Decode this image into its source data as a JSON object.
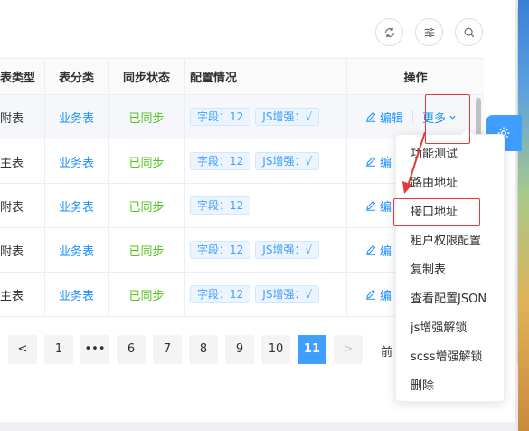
{
  "toolbar": {
    "icons": [
      "refresh-icon",
      "columns-settings-icon",
      "search-icon"
    ]
  },
  "table": {
    "headers": [
      "表类型",
      "表分类",
      "同步状态",
      "配置情况",
      "操作"
    ],
    "rows": [
      {
        "type": "附表",
        "category": "业务表",
        "sync": "已同步",
        "tags": [
          "字段：12",
          "JS增强：√"
        ],
        "edit": "编辑",
        "more": "更多"
      },
      {
        "type": "主表",
        "category": "业务表",
        "sync": "已同步",
        "tags": [
          "字段：12",
          "JS增强：√"
        ],
        "edit": "编"
      },
      {
        "type": "附表",
        "category": "业务表",
        "sync": "已同步",
        "tags": [
          "字段：12"
        ],
        "edit": "编"
      },
      {
        "type": "附表",
        "category": "业务表",
        "sync": "已同步",
        "tags": [
          "字段：12",
          "JS增强：√"
        ],
        "edit": "编"
      },
      {
        "type": "主表",
        "category": "业务表",
        "sync": "已同步",
        "tags": [
          "字段：12",
          "JS增强：√"
        ],
        "edit": "编"
      }
    ]
  },
  "dropdown": {
    "items": [
      "功能测试",
      "路由地址",
      "接口地址",
      "租户权限配置",
      "复制表",
      "查看配置JSON",
      "js增强解锁",
      "scss增强解锁",
      "删除"
    ],
    "highlighted_index": 2
  },
  "pagination": {
    "prev": "<",
    "pages": [
      "1",
      "•••",
      "6",
      "7",
      "8",
      "9",
      "10",
      "11"
    ],
    "current": "11",
    "next": ">",
    "goto_label": "前"
  },
  "colors": {
    "primary": "#409eff",
    "success": "#52c41a",
    "annotation": "#e53935"
  }
}
